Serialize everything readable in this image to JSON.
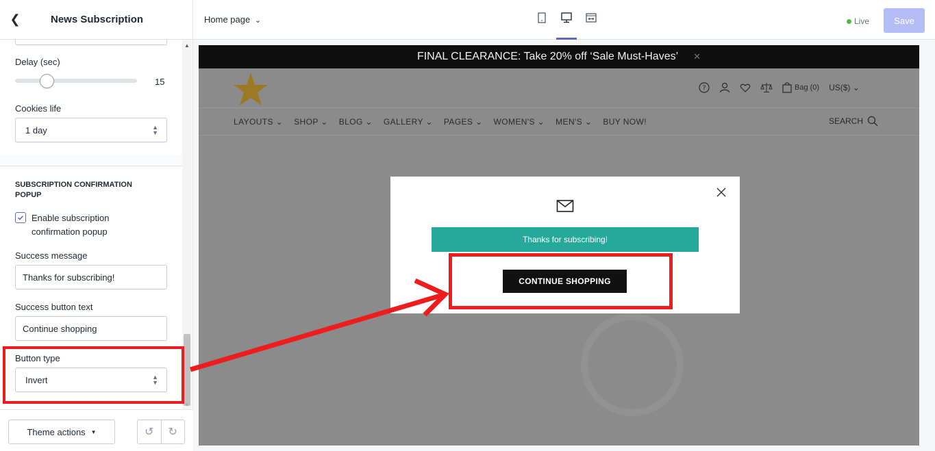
{
  "sidebar": {
    "title": "News Subscription",
    "delay_label": "Delay (sec)",
    "delay_value": "15",
    "delay_fraction": 0.27,
    "cookies_label": "Cookies life",
    "cookies_value": "1 day",
    "section_title": "SUBSCRIPTION CONFIRMATION POPUP",
    "enable_label": "Enable subscription confirmation popup",
    "enable_checked": true,
    "success_message_label": "Success message",
    "success_message_value": "Thanks for subscribing!",
    "success_button_label": "Success button text",
    "success_button_value": "Continue shopping",
    "button_type_label": "Button type",
    "button_type_value": "Invert",
    "theme_actions": "Theme actions"
  },
  "topbar": {
    "page": "Home page",
    "live": "Live",
    "save": "Save"
  },
  "preview": {
    "announcement": "FINAL CLEARANCE: Take 20% off ‘Sale Must-Haves’",
    "bag": "Bag (0)",
    "currency": "US($)",
    "nav": [
      "LAYOUTS",
      "SHOP",
      "BLOG",
      "GALLERY",
      "PAGES",
      "WOMEN'S",
      "MEN'S",
      "BUY NOW!"
    ],
    "search": "SEARCH",
    "modal": {
      "success_text": "Thanks for subscribing!",
      "button_text": "CONTINUE SHOPPING"
    }
  },
  "colors": {
    "accent": "#5c6ac4",
    "success_bar": "#26a99a",
    "annotation_red": "#ee1c1c",
    "star": "#c9931c"
  }
}
